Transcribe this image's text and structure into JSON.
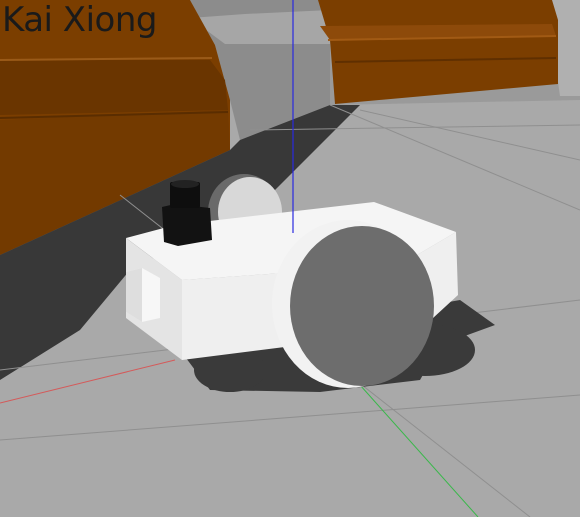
{
  "caption": {
    "author": "Kai Xiong"
  },
  "colors": {
    "ground": "#a8a8a8",
    "grid_line": "#8e8e8e",
    "wall_brown": "#7a3c00",
    "wall_gray": "#9c9c9c",
    "robot_body": "#f2f2f2",
    "wheel": "#6e6e6e",
    "sensor": "#111111",
    "axis_x": "#d45a5a",
    "axis_y": "#39b84a",
    "axis_z": "#2a2ae0"
  }
}
